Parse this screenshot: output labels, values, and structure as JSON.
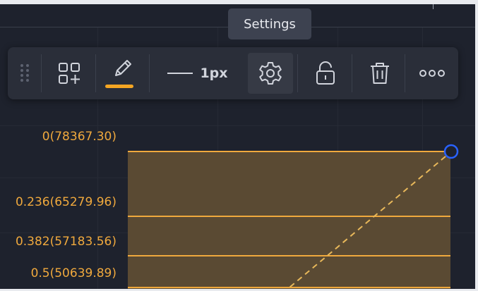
{
  "tooltip": {
    "text": "Settings"
  },
  "toolbar": {
    "drag_handle_icon": "drag-handle-icon",
    "templates_icon": "add-template-icon",
    "brush_icon": "pencil-icon",
    "line_width_label": "1px",
    "settings_icon": "gear-icon",
    "lock_icon": "unlock-icon",
    "delete_icon": "trash-icon",
    "more_icon": "more-icon",
    "color_accent": "#f5a623"
  },
  "fib_levels": [
    {
      "label": "0(78367.30)"
    },
    {
      "label": "0.236(65279.96)"
    },
    {
      "label": "0.382(57183.56)"
    },
    {
      "label": "0.5(50639.89)"
    }
  ],
  "colors": {
    "fib_line": "#f0a93d",
    "fib_fill": "#5a4a33",
    "anchor_point": "#2962ff",
    "background": "#1e222d",
    "toolbar_bg": "#2a2e39"
  }
}
